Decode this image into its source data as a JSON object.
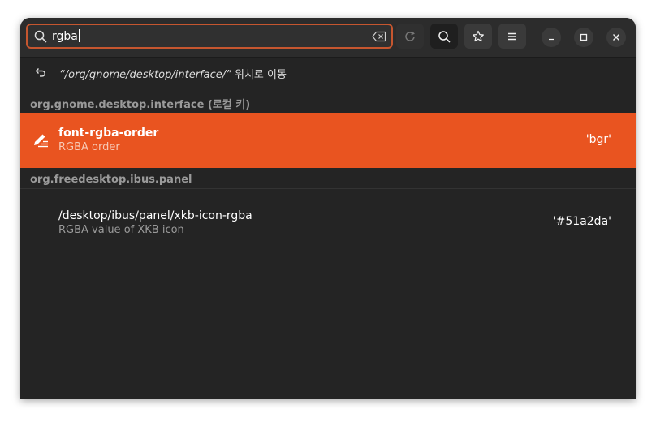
{
  "search": {
    "value": "rgba"
  },
  "header": {
    "icons": {
      "search_icon": "magnifier",
      "clear_icon": "backspace",
      "reload_icon": "reload",
      "search_toggle_icon": "magnifier",
      "bookmark_icon": "star",
      "menu_icon": "hamburger",
      "minimize_icon": "minimize",
      "maximize_icon": "maximize",
      "close_icon": "close"
    }
  },
  "path_row": {
    "quoted_path": "“/org/gnome/desktop/interface/”",
    "suffix": " 위치로 이동"
  },
  "sections": [
    {
      "title": "org.gnome.desktop.interface (로컬 키)",
      "rows": [
        {
          "key": "font-rgba-order",
          "summary": "RGBA order",
          "value": "'bgr'",
          "selected": true
        }
      ]
    },
    {
      "title": "org.freedesktop.ibus.panel",
      "rows": [
        {
          "key": "/desktop/ibus/panel/xkb-icon-rgba",
          "summary": "RGBA value of XKB icon",
          "value": "'#51a2da'",
          "selected": false
        }
      ]
    }
  ],
  "colors": {
    "accent": "#e95420",
    "window_bg": "#242424",
    "headerbar_bg": "#2c2c2c"
  }
}
